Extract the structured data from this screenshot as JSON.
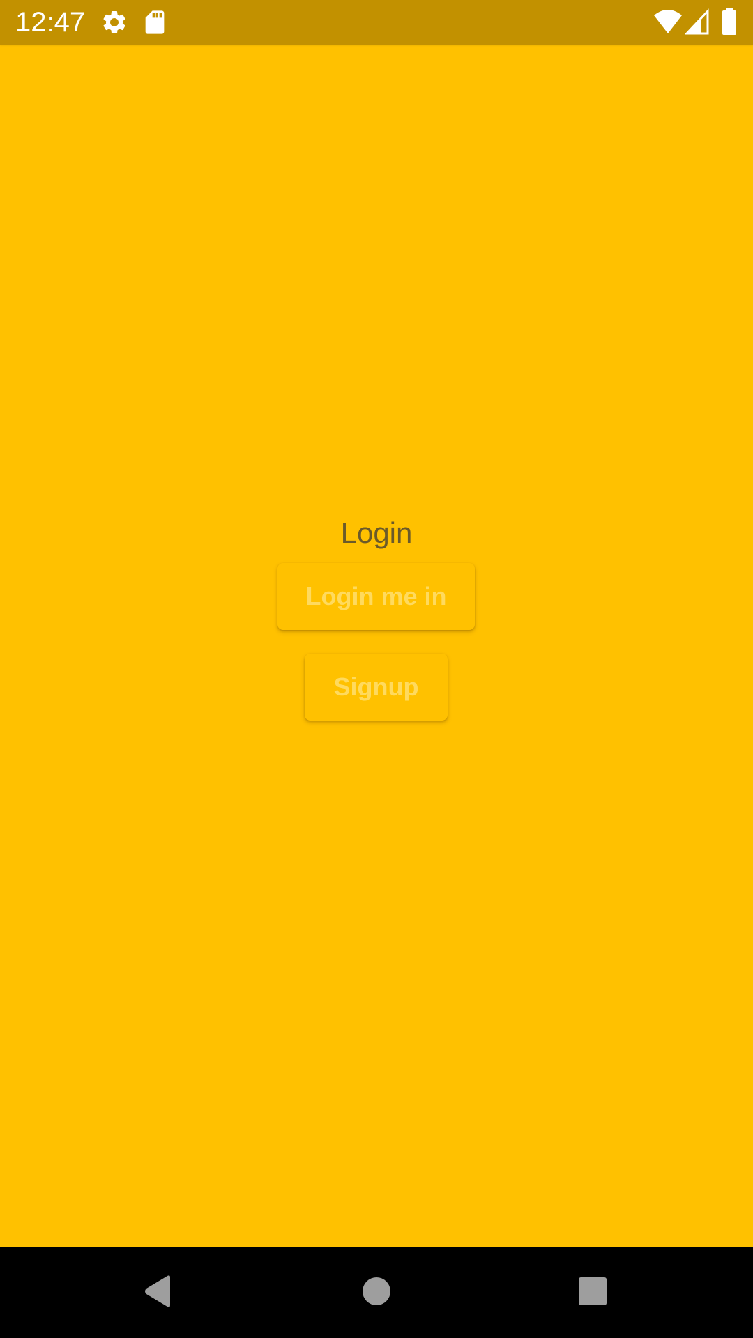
{
  "status_bar": {
    "time": "12:47",
    "background": "#C29100",
    "icons": [
      "settings-icon",
      "sd-card-icon",
      "wifi-icon",
      "signal-icon",
      "battery-icon"
    ]
  },
  "screen": {
    "background": "#FFC100",
    "title": "Login",
    "buttons": {
      "login_label": "Login me in",
      "signup_label": "Signup"
    }
  },
  "nav_bar": {
    "background": "#000000",
    "icons": [
      "back-icon",
      "home-icon",
      "recents-icon"
    ]
  }
}
